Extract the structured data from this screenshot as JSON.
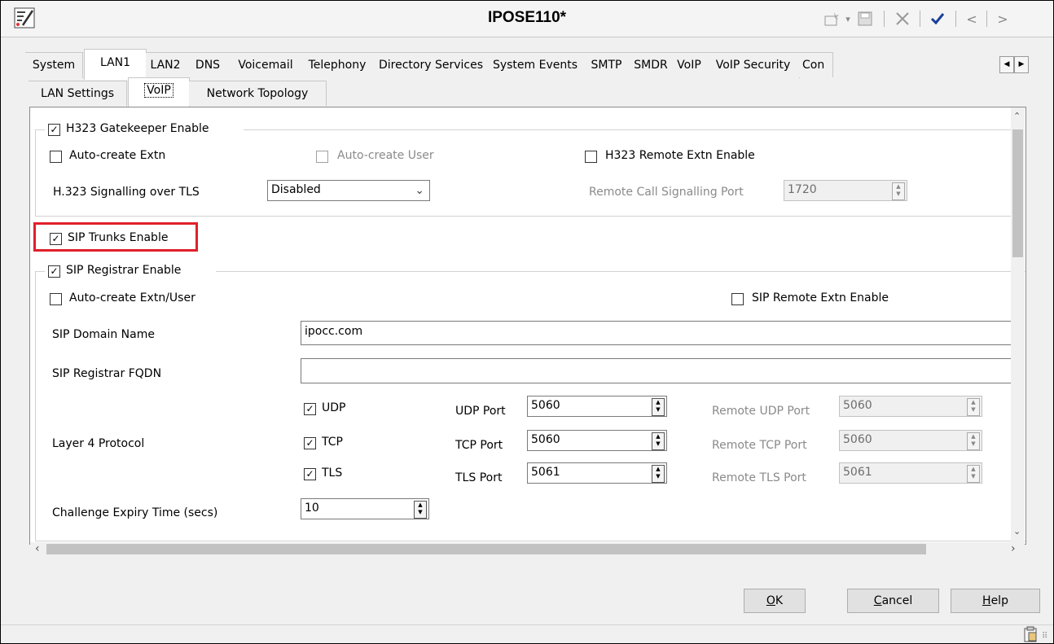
{
  "window": {
    "title": "IPOSE110*",
    "toolbar_icons": [
      "new-record-icon",
      "dropdown-arrow-icon",
      "save-icon",
      "delete-icon",
      "validate-checkmark-icon",
      "previous-icon",
      "next-icon"
    ]
  },
  "tabs": [
    "System",
    "LAN1",
    "LAN2",
    "DNS",
    "Voicemail",
    "Telephony",
    "Directory Services",
    "System Events",
    "SMTP",
    "SMDR",
    "VoIP",
    "VoIP Security",
    "Con"
  ],
  "active_tab": "LAN1",
  "subtabs": [
    "LAN Settings",
    "VoIP",
    "Network Topology"
  ],
  "active_subtab": "VoIP",
  "h323": {
    "gatekeeper_label": "H323 Gatekeeper Enable",
    "gatekeeper_checked": true,
    "auto_create_extn": "Auto-create Extn",
    "auto_create_user": "Auto-create User",
    "remote_extn": "H323 Remote Extn Enable",
    "signalling_tls_label": "H.323 Signalling over TLS",
    "signalling_tls_value": "Disabled",
    "remote_port_label": "Remote Call Signalling Port",
    "remote_port_value": "1720"
  },
  "sip_trunks": {
    "label": "SIP Trunks Enable",
    "checked": true,
    "highlight_color": "#e0202a"
  },
  "sip_registrar": {
    "label": "SIP Registrar Enable",
    "checked": true,
    "auto_create_label": "Auto-create Extn/User",
    "remote_extn_label": "SIP Remote Extn Enable",
    "domain_label": "SIP Domain Name",
    "domain_value": "ipocc.com",
    "fqdn_label": "SIP Registrar FQDN",
    "fqdn_value": "",
    "layer4_label": "Layer 4 Protocol",
    "udp": {
      "label": "UDP",
      "port_label": "UDP Port",
      "port": "5060",
      "remote_label": "Remote UDP Port",
      "remote_port": "5060"
    },
    "tcp": {
      "label": "TCP",
      "port_label": "TCP Port",
      "port": "5060",
      "remote_label": "Remote TCP Port",
      "remote_port": "5060"
    },
    "tls": {
      "label": "TLS",
      "port_label": "TLS Port",
      "port": "5061",
      "remote_label": "Remote TLS Port",
      "remote_port": "5061"
    },
    "challenge_label": "Challenge Expiry Time (secs)",
    "challenge_value": "10"
  },
  "buttons": {
    "ok_prefix": "",
    "ok_mnemonic": "O",
    "ok_rest": "K",
    "cancel_mnemonic": "C",
    "cancel_rest": "ancel",
    "help_mnemonic": "H",
    "help_rest": "elp"
  }
}
